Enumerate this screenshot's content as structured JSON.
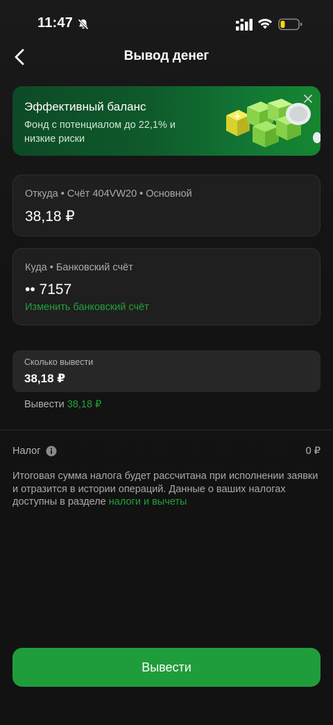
{
  "status_bar": {
    "time": "11:47",
    "icons": [
      "bell-muted-icon",
      "signal-icon",
      "wifi-icon",
      "battery-icon"
    ]
  },
  "header": {
    "title": "Вывод денег",
    "back_icon": "chevron-left-icon"
  },
  "promo": {
    "title": "Эффективный баланс",
    "text": "Фонд с потенциалом до 22,1% и низкие риски",
    "close_icon": "close-icon"
  },
  "from_card": {
    "label": "Откуда • Счёт 404VW20 • Основной",
    "value": "38,18 ₽"
  },
  "to_card": {
    "label": "Куда • Банковский счёт",
    "value": "•• 7157",
    "link": "Изменить банковский счёт"
  },
  "amount": {
    "label": "Сколько вывести",
    "value": "38,18 ₽"
  },
  "withdraw_all": {
    "prefix": "Вывести",
    "amount": "38,18 ₽"
  },
  "tax": {
    "label": "Налог",
    "value": "0 ₽",
    "note": "Итоговая сумма налога будет рассчитана при исполнении заявки и отразится в истории операций. Данные о ваших налогах доступны в разделе",
    "link": "налоги и вычеты"
  },
  "submit": {
    "label": "Вывести"
  },
  "colors": {
    "accent": "#21a038",
    "button": "#1f9d3b",
    "background": "#141414",
    "card": "#1f1f1f"
  }
}
